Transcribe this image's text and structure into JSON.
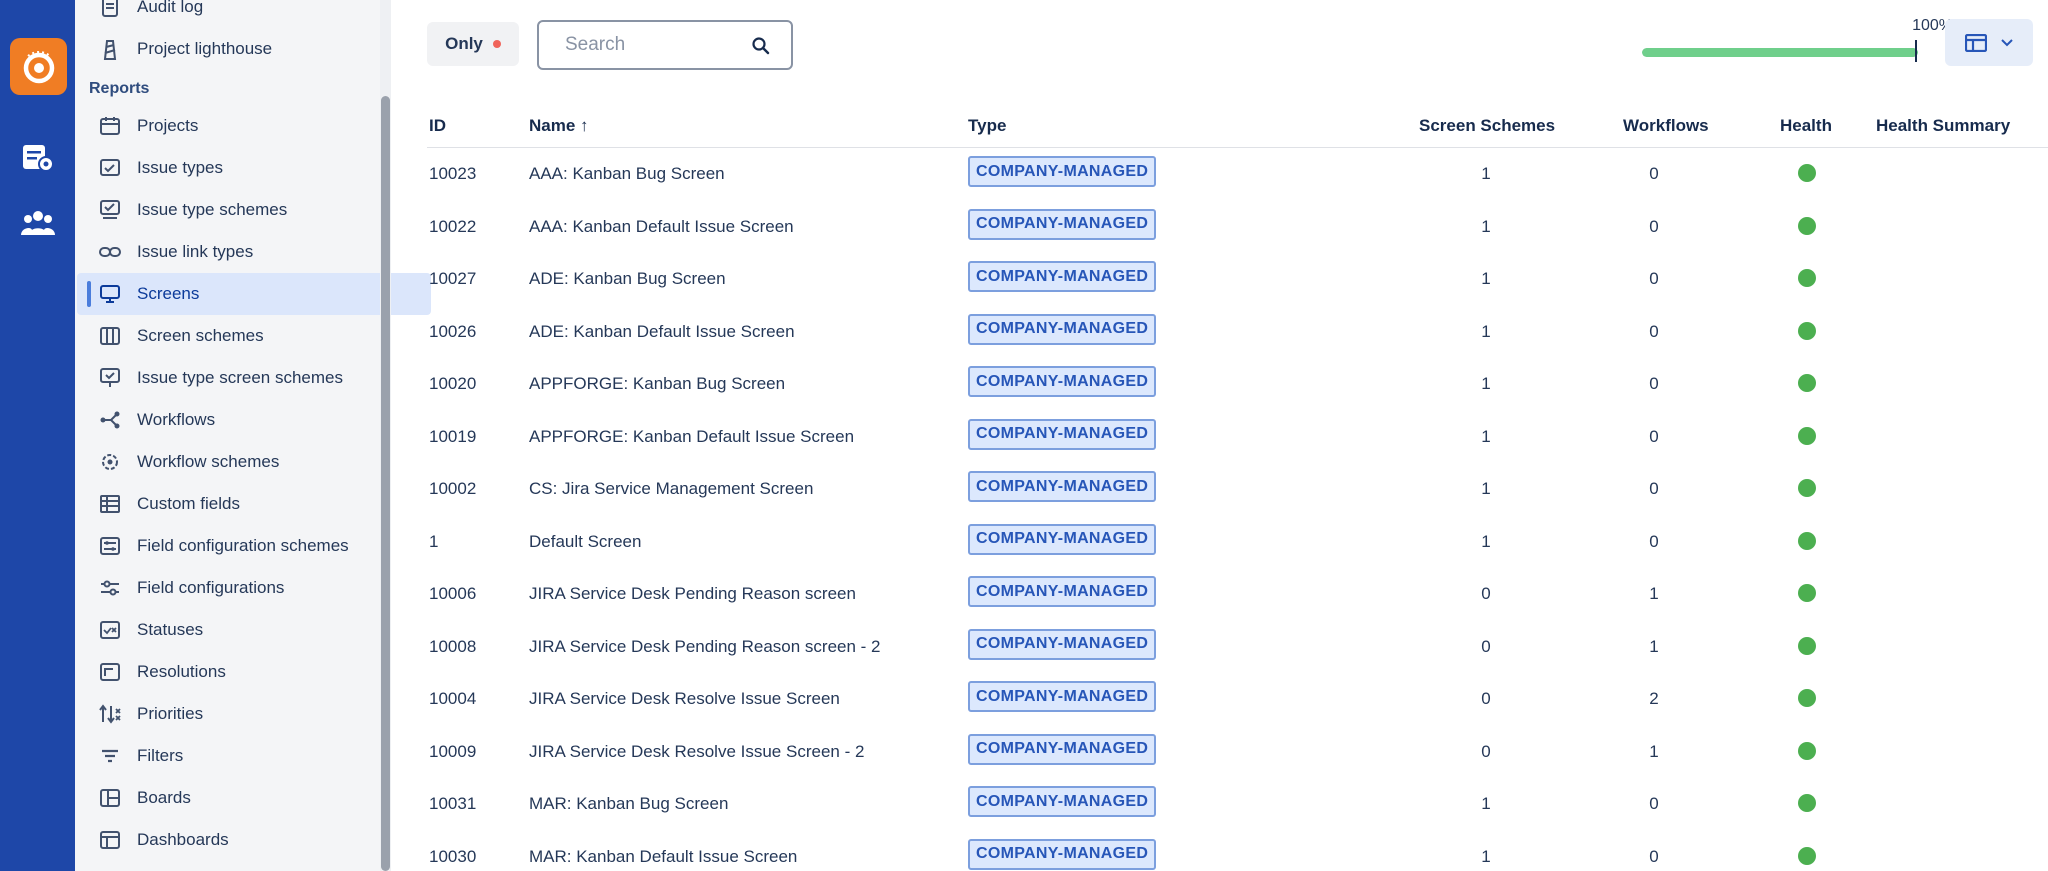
{
  "sidebar": {
    "partial_top_label": "Audit log",
    "top_item": "Project lighthouse",
    "section_title": "Reports",
    "items": [
      {
        "label": "Projects",
        "icon": "calendar-icon",
        "active": false
      },
      {
        "label": "Issue types",
        "icon": "issue-type-icon",
        "active": false
      },
      {
        "label": "Issue type schemes",
        "icon": "issue-type-scheme-icon",
        "active": false
      },
      {
        "label": "Issue link types",
        "icon": "link-icon",
        "active": false
      },
      {
        "label": "Screens",
        "icon": "monitor-icon",
        "active": true
      },
      {
        "label": "Screen schemes",
        "icon": "columns-icon",
        "active": false
      },
      {
        "label": "Issue type screen schemes",
        "icon": "monitor-check-icon",
        "active": false
      },
      {
        "label": "Workflows",
        "icon": "workflow-icon",
        "active": false
      },
      {
        "label": "Workflow schemes",
        "icon": "workflow-scheme-icon",
        "active": false
      },
      {
        "label": "Custom fields",
        "icon": "table-icon",
        "active": false
      },
      {
        "label": "Field configuration schemes",
        "icon": "field-config-scheme-icon",
        "active": false
      },
      {
        "label": "Field configurations",
        "icon": "sliders-icon",
        "active": false
      },
      {
        "label": "Statuses",
        "icon": "status-icon",
        "active": false
      },
      {
        "label": "Resolutions",
        "icon": "resolution-icon",
        "active": false
      },
      {
        "label": "Priorities",
        "icon": "priority-icon",
        "active": false
      },
      {
        "label": "Filters",
        "icon": "filter-icon",
        "active": false
      },
      {
        "label": "Boards",
        "icon": "board-icon",
        "active": false
      },
      {
        "label": "Dashboards",
        "icon": "dashboard-icon",
        "active": false
      }
    ]
  },
  "toolbar": {
    "only_label": "Only",
    "search_placeholder": "Search",
    "progress_label": "100%",
    "progress_value": 1.0
  },
  "table": {
    "columns": [
      "ID",
      "Name ↑",
      "Type",
      "Screen Schemes",
      "Workflows",
      "Health",
      "Health Summary"
    ],
    "rows": [
      {
        "id": "10023",
        "name": "AAA: Kanban Bug Screen",
        "type": "COMPANY-MANAGED",
        "screen_schemes": "1",
        "workflows": "0",
        "health": "green"
      },
      {
        "id": "10022",
        "name": "AAA: Kanban Default Issue Screen",
        "type": "COMPANY-MANAGED",
        "screen_schemes": "1",
        "workflows": "0",
        "health": "green"
      },
      {
        "id": "10027",
        "name": "ADE: Kanban Bug Screen",
        "type": "COMPANY-MANAGED",
        "screen_schemes": "1",
        "workflows": "0",
        "health": "green"
      },
      {
        "id": "10026",
        "name": "ADE: Kanban Default Issue Screen",
        "type": "COMPANY-MANAGED",
        "screen_schemes": "1",
        "workflows": "0",
        "health": "green"
      },
      {
        "id": "10020",
        "name": "APPFORGE: Kanban Bug Screen",
        "type": "COMPANY-MANAGED",
        "screen_schemes": "1",
        "workflows": "0",
        "health": "green"
      },
      {
        "id": "10019",
        "name": "APPFORGE: Kanban Default Issue Screen",
        "type": "COMPANY-MANAGED",
        "screen_schemes": "1",
        "workflows": "0",
        "health": "green"
      },
      {
        "id": "10002",
        "name": "CS: Jira Service Management Screen",
        "type": "COMPANY-MANAGED",
        "screen_schemes": "1",
        "workflows": "0",
        "health": "green"
      },
      {
        "id": "1",
        "name": "Default Screen",
        "type": "COMPANY-MANAGED",
        "screen_schemes": "1",
        "workflows": "0",
        "health": "green"
      },
      {
        "id": "10006",
        "name": "JIRA Service Desk Pending Reason screen",
        "type": "COMPANY-MANAGED",
        "screen_schemes": "0",
        "workflows": "1",
        "health": "green"
      },
      {
        "id": "10008",
        "name": "JIRA Service Desk Pending Reason screen - 2",
        "type": "COMPANY-MANAGED",
        "screen_schemes": "0",
        "workflows": "1",
        "health": "green"
      },
      {
        "id": "10004",
        "name": "JIRA Service Desk Resolve Issue Screen",
        "type": "COMPANY-MANAGED",
        "screen_schemes": "0",
        "workflows": "2",
        "health": "green"
      },
      {
        "id": "10009",
        "name": "JIRA Service Desk Resolve Issue Screen - 2",
        "type": "COMPANY-MANAGED",
        "screen_schemes": "0",
        "workflows": "1",
        "health": "green"
      },
      {
        "id": "10031",
        "name": "MAR: Kanban Bug Screen",
        "type": "COMPANY-MANAGED",
        "screen_schemes": "1",
        "workflows": "0",
        "health": "green"
      },
      {
        "id": "10030",
        "name": "MAR: Kanban Default Issue Screen",
        "type": "COMPANY-MANAGED",
        "screen_schemes": "1",
        "workflows": "0",
        "health": "green"
      }
    ]
  },
  "colors": {
    "rail": "#1e47a8",
    "logo": "#f07d24",
    "health_green": "#4caf50",
    "badge_text": "#2756b8"
  }
}
